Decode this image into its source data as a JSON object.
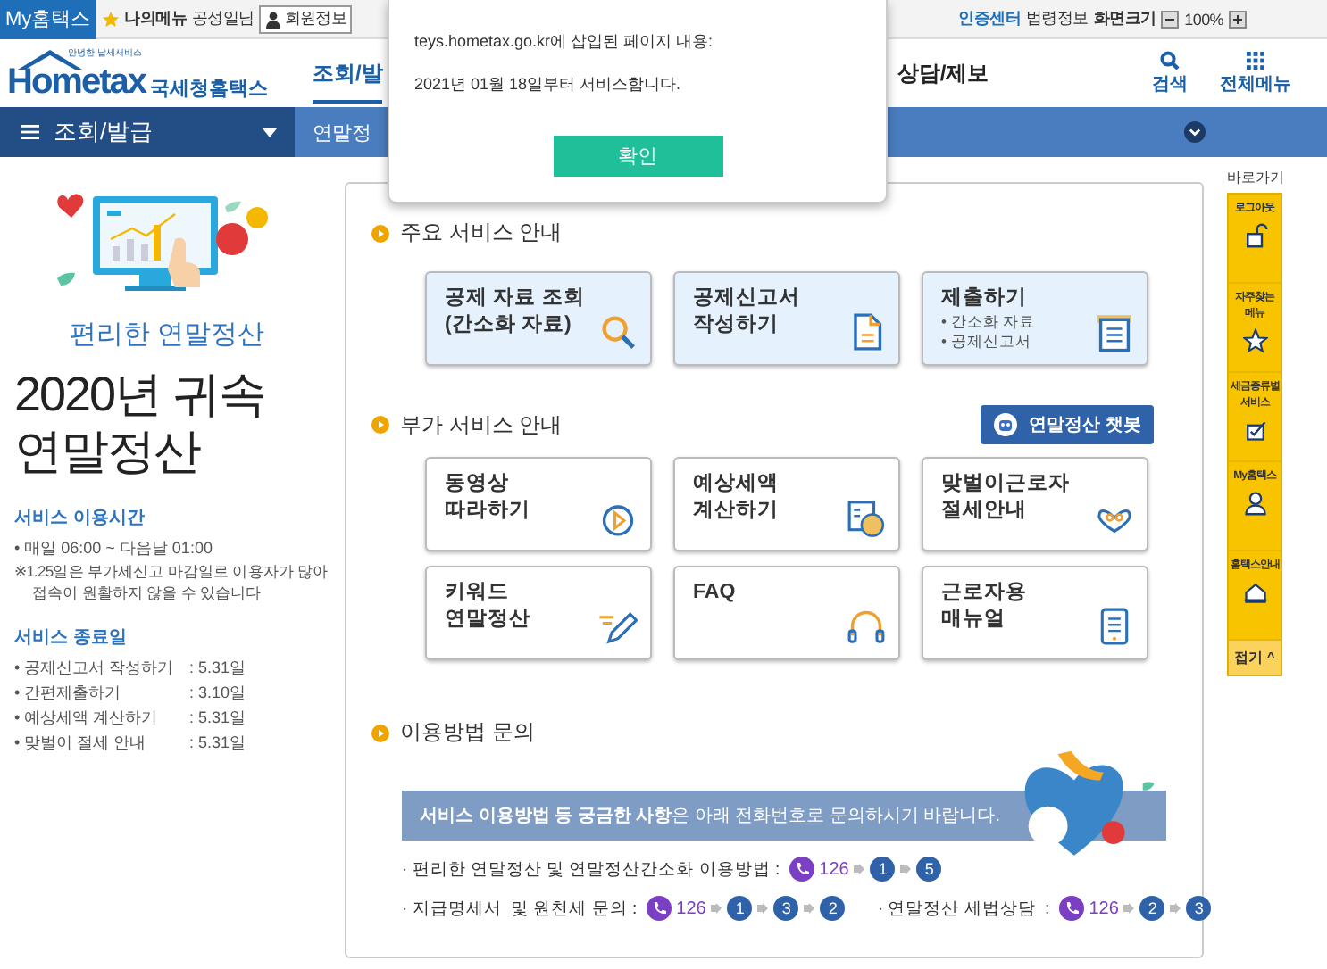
{
  "top_bar": {
    "my_hometax": "My홈택스",
    "my_menu": "나의메뉴",
    "user_name": "공성일님",
    "member_info": "회원정보",
    "cert_center": "인증센터",
    "law_info": "법령정보",
    "screen_size": "화면크기",
    "zoom_level": "100%"
  },
  "header": {
    "logo": {
      "tagline": "안녕한 납세서비스",
      "brand": "Hometax",
      "name": "국세청홈택스"
    },
    "nav": [
      {
        "label": "조회/발",
        "selected": true
      },
      {
        "label": "상담/제보",
        "selected": false
      }
    ],
    "search": "검색",
    "all_menu": "전체메뉴"
  },
  "breadcrumb": {
    "menu": "조회/발급",
    "current": "연말정"
  },
  "dialog": {
    "title": "teys.hometax.go.kr에 삽입된 페이지 내용:",
    "message": "2021년 01월 18일부터 서비스합니다.",
    "ok": "확인"
  },
  "promo": {
    "subtitle": "편리한 연말정산",
    "title": "2020년 귀속\n연말정산"
  },
  "service_hours": {
    "heading": "서비스 이용시간",
    "items": [
      "• 매일 06:00 ~ 다음날 01:00"
    ],
    "note": "※1.25일은 부가세신고 마감일로 이용자가 많아 접속이 원활하지 않을 수 있습니다"
  },
  "end_dates": {
    "heading": "서비스 종료일",
    "rows": [
      {
        "label": "• 공제신고서 작성하기",
        "date": ": 5.31일"
      },
      {
        "label": "• 간편제출하기",
        "date": ": 3.10일"
      },
      {
        "label": "• 예상세액 계산하기",
        "date": ": 5.31일"
      },
      {
        "label": "• 맞벌이 절세 안내",
        "date": ": 5.31일"
      }
    ]
  },
  "main_services": {
    "title": "주요 서비스 안내",
    "cards": [
      {
        "title": "공제 자료 조회\n(간소화 자료)",
        "highlight": true
      },
      {
        "title": "공제신고서\n작성하기",
        "highlight": true
      },
      {
        "title": "제출하기",
        "sub": [
          "• 간소화 자료",
          "• 공제신고서"
        ],
        "highlight": true
      }
    ]
  },
  "extra_services": {
    "title": "부가 서비스 안내",
    "chatbot": "연말정산 챗봇",
    "cards": [
      {
        "title": "동영상\n따라하기",
        "highlight": false
      },
      {
        "title": "예상세액\n계산하기",
        "highlight": false
      },
      {
        "title": "맞벌이근로자\n절세안내",
        "highlight": false
      },
      {
        "title": "키워드\n연말정산",
        "highlight": false
      },
      {
        "title": "FAQ",
        "highlight": false
      },
      {
        "title": "근로자용\n매뉴얼",
        "highlight": false
      }
    ]
  },
  "inquiry": {
    "title": "이용방법 문의",
    "banner": "**서비스 이용방법 등 궁금한 사항**은 아래 전화번호로 문의하시기 바랍니다.",
    "lines": [
      {
        "groups": [
          {
            "label": "· 편리한 연말정산 및 연말정산간소화 이용방법 :",
            "number": "126",
            "steps": [
              "1",
              "5"
            ]
          }
        ]
      },
      {
        "groups": [
          {
            "label": "· 지급명세서  및 원천세 문의 :",
            "number": "126",
            "steps": [
              "1",
              "3",
              "2"
            ]
          },
          {
            "label": "· 연말정산 세법상담  :",
            "number": "126",
            "steps": [
              "2",
              "3"
            ]
          }
        ]
      }
    ]
  },
  "quick_menu": {
    "title": "바로가기",
    "items": [
      {
        "label": "로그아웃"
      },
      {
        "label": "자주찾는\n메뉴"
      },
      {
        "label": "세금종류별\n서비스"
      },
      {
        "label": "My홈택스"
      },
      {
        "label": "홈택스안내"
      }
    ],
    "fold": "접기 ^"
  }
}
